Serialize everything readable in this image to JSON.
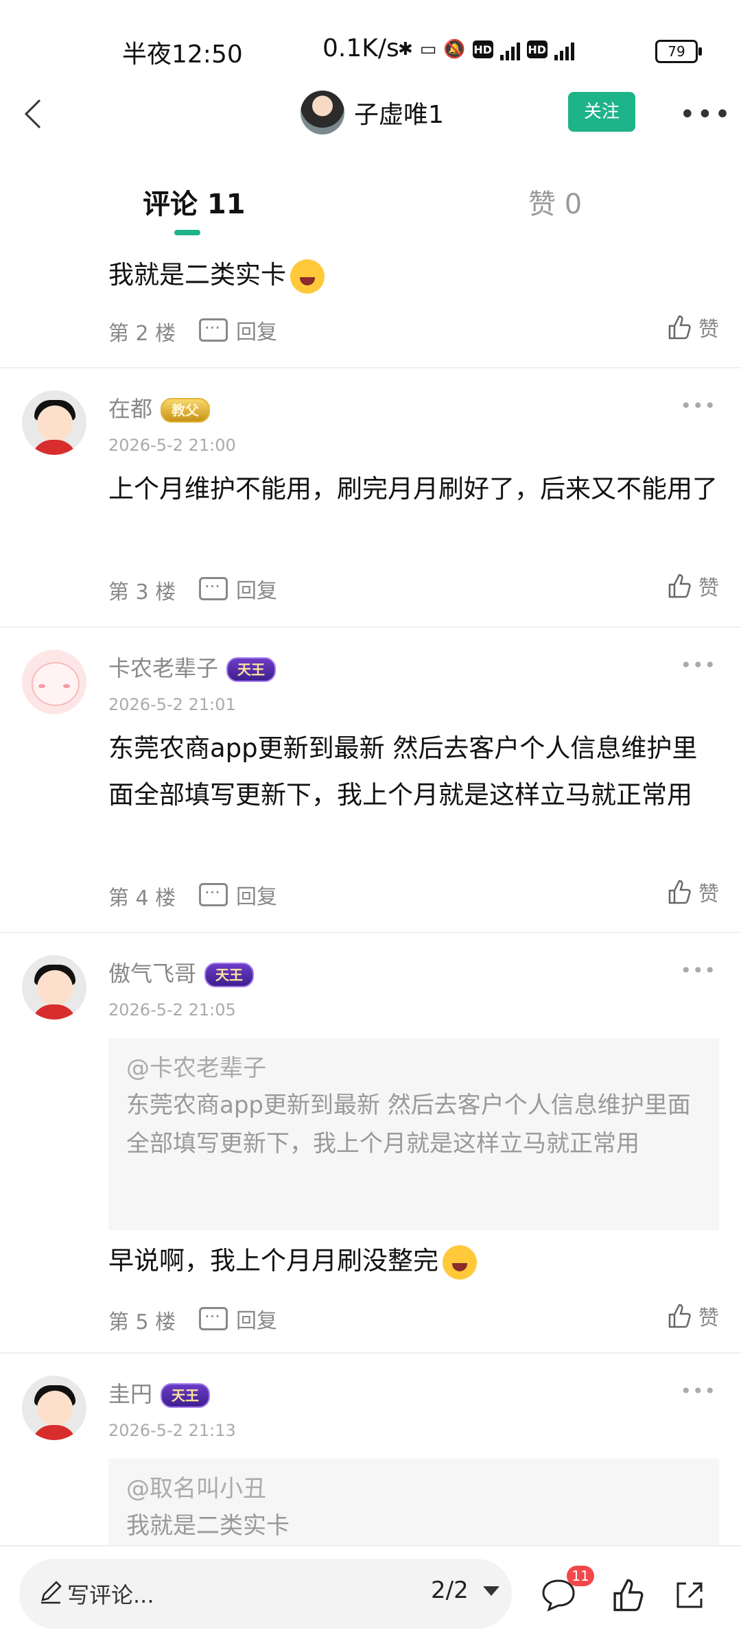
{
  "status_bar": {
    "time": "半夜12:50",
    "net_speed": "0.1K/s",
    "battery": "79"
  },
  "nav": {
    "author_name": "子虚唯1",
    "follow_label": "关注"
  },
  "tabs": {
    "comments_label": "评论 11",
    "likes_label": "赞 0"
  },
  "labels": {
    "reply": "回复",
    "like": "赞"
  },
  "comments": [
    {
      "text": "我就是二类实卡",
      "floor": "第 2 楼"
    },
    {
      "user": "在都",
      "badge": "教父",
      "time": "2026-5-2 21:00",
      "text": "上个月维护不能用，刷完月月刷好了，后来又不能用了",
      "floor": "第 3 楼"
    },
    {
      "user": "卡农老辈子",
      "badge": "天王",
      "time": "2026-5-2 21:01",
      "text": "东莞农商app更新到最新  然后去客户个人信息维护里面全部填写更新下，我上个月就是这样立马就正常用",
      "floor": "第 4 楼"
    },
    {
      "user": "傲气飞哥",
      "badge": "天王",
      "time": "2026-5-2 21:05",
      "quote_user": "@卡农老辈子",
      "quote_text": "东莞农商app更新到最新  然后去客户个人信息维护里面全部填写更新下，我上个月就是这样立马就正常用",
      "text": "早说啊，我上个月月刷没整完",
      "floor": "第 5 楼"
    },
    {
      "user": "圭円",
      "badge": "天王",
      "time": "2026-5-2 21:13",
      "quote_user": "@取名叫小丑",
      "quote_text": "我就是二类实卡"
    }
  ],
  "bottom_bar": {
    "input_placeholder": "写评论...",
    "page": "2/2",
    "comment_count": "11"
  },
  "colors": {
    "accent": "#1fb38a",
    "badge_red": "#f2484b"
  }
}
